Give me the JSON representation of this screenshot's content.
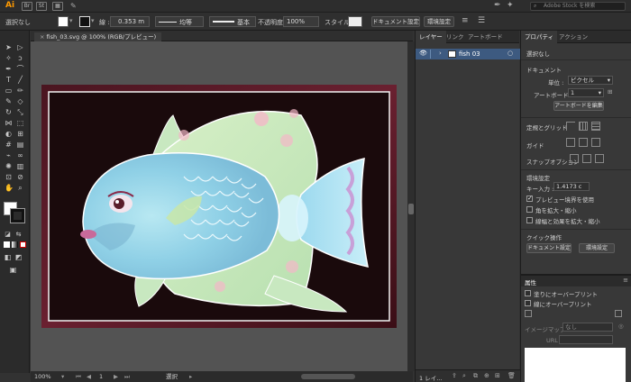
{
  "menubar": {
    "logo": "Ai",
    "apps": [
      "Br",
      "St"
    ],
    "search_placeholder": "Adobe Stock を検索"
  },
  "control": {
    "selection_label": "選択なし",
    "stroke_label": "線 :",
    "stroke_value": "0.353 m",
    "profile_uniform": "均等",
    "brush_basic": "基本",
    "opacity_label": "不透明度 :",
    "opacity_value": "100%",
    "style_label": "スタイル :",
    "document_setup_button": "ドキュメント設定",
    "preferences_button": "環境設定"
  },
  "document": {
    "tab_title": "fish_03.svg @ 100% (RGB/プレビュー)",
    "zoom": "100%",
    "artboard_number": "1",
    "status_text": "選択"
  },
  "layers_panel": {
    "tabs": [
      "レイヤー",
      "リンク",
      "アートボード"
    ],
    "layers": [
      {
        "name": "fish 03"
      }
    ],
    "footer": "1 レイ..."
  },
  "properties_panel": {
    "tabs": [
      "プロパティ",
      "アクション"
    ],
    "selection": "選択なし",
    "document_header": "ドキュメント",
    "units_label": "単位 :",
    "units_value": "ピクセル",
    "artboard_label": "アートボード :",
    "artboard_value": "1",
    "edit_artboard_button": "アートボードを編集",
    "rulers_grid": "定規とグリッド",
    "guides": "ガイド",
    "snap_options": "スナップオプション",
    "prefs_header": "環境設定",
    "key_increment_label": "キー入力 :",
    "key_increment_value": "1.4173 c",
    "preview_bounds": "プレビュー境界を使用",
    "scale_corners": "角を拡大・縮小",
    "scale_strokes": "線幅と効果を拡大・縮小",
    "quick_actions": "クイック操作",
    "doc_setup_button": "ドキュメント設定",
    "prefs_button": "環境設定"
  },
  "attributes_panel": {
    "title": "属性",
    "overprint_fill": "塗りにオーバープリント",
    "overprint_stroke": "線にオーバープリント",
    "image_map_label": "イメージマップ :",
    "image_map_value": "なし",
    "url_label": "URL :"
  },
  "checkbox_states": {
    "preview_bounds": true,
    "scale_corners": false,
    "scale_strokes": false,
    "overprint_fill": false,
    "overprint_stroke": false
  },
  "colors": {
    "accent": "#3d5a80",
    "artboard_bg": "#1a0a0c",
    "frame": "#5a1a24",
    "fish_body": "#9fd9ea"
  }
}
